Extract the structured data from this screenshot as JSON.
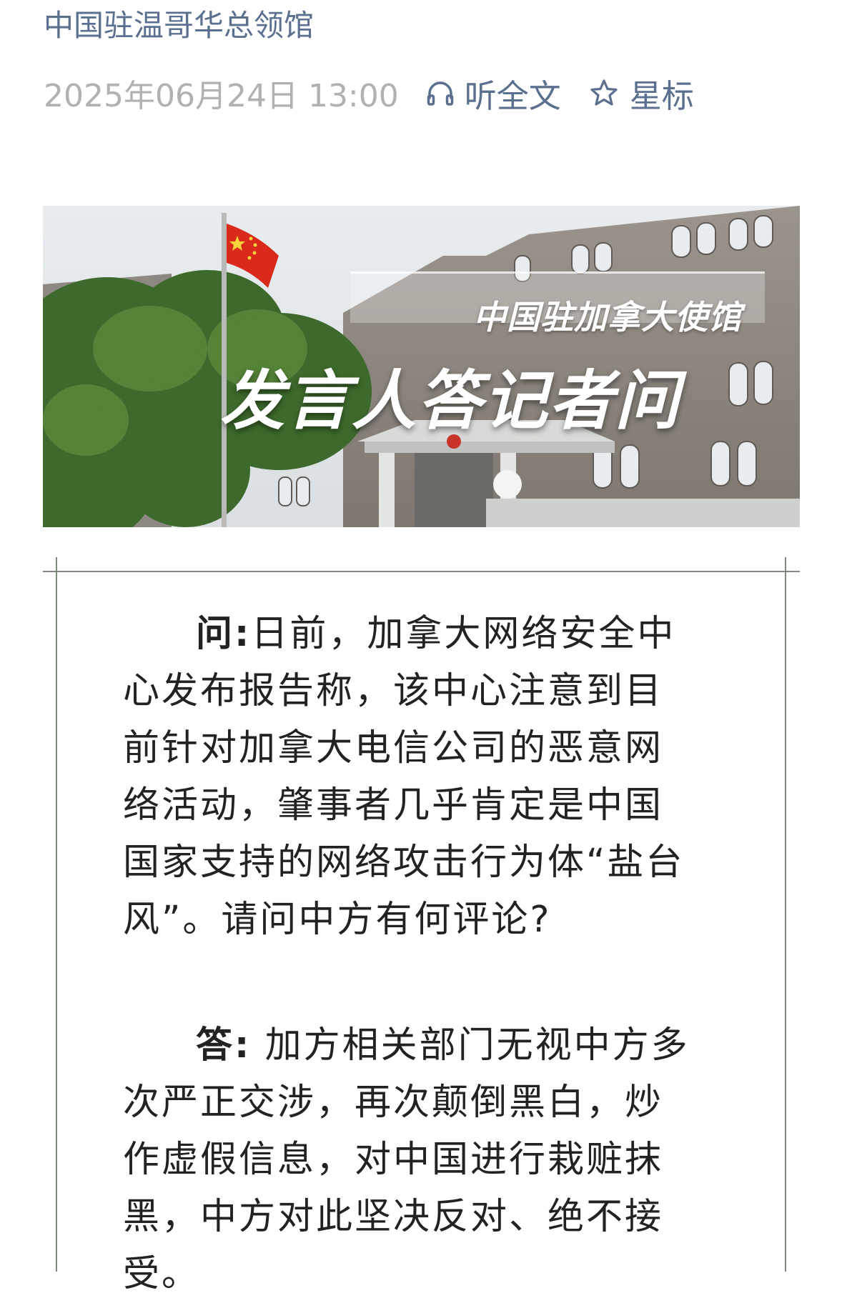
{
  "header": {
    "account_name": "中国驻温哥华总领馆",
    "date": "2025年06月24日 13:00",
    "listen_label": "听全文",
    "star_label": "星标",
    "colors": {
      "link": "#5b6f8f",
      "meta": "#b1b1b1"
    }
  },
  "banner": {
    "subtitle": "中国驻加拿大使馆",
    "title": "发言人答记者问"
  },
  "article": {
    "question": {
      "label": "问:",
      "text": "日前，加拿大网络安全中心发布报告称，该中心注意到目前针对加拿大电信公司的恶意网络活动，肇事者几乎肯定是中国国家支持的网络攻击行为体“盐台风”。请问中方有何评论?"
    },
    "answer": {
      "label": "答:",
      "text": " 加方相关部门无视中方多次严正交涉，再次颠倒黑白，炒作虚假信息，对中国进行栽赃抹黑，中方对此坚决反对、绝不接受。"
    }
  }
}
